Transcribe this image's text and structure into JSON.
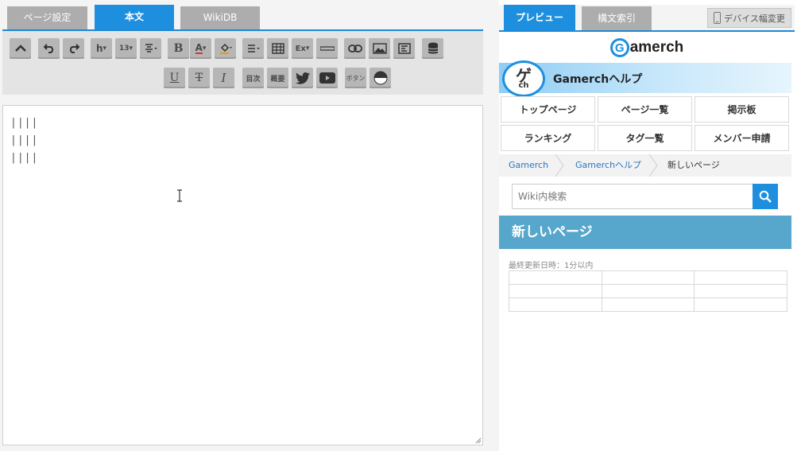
{
  "editor": {
    "tabs": [
      {
        "label": "ページ設定"
      },
      {
        "label": "本文"
      },
      {
        "label": "WikiDB"
      }
    ],
    "toolbar": {
      "heading_label": "h",
      "fontsize_label": "13",
      "bold_label": "B",
      "color_label": "A",
      "ex_label": "Ex",
      "underline_label": "U",
      "strike_label": "T",
      "italic_label": "I",
      "toc_label": "目次",
      "summary_label": "概要",
      "button_label": "ボタン"
    },
    "lines": [
      "||||",
      "||||",
      "||||"
    ]
  },
  "preview": {
    "tabs": [
      {
        "label": "プレビュー"
      },
      {
        "label": "構文索引"
      }
    ],
    "device_button": "デバイス幅変更",
    "brand": {
      "g": "G",
      "rest": "amerch"
    },
    "logo": {
      "kana": "ゲ",
      "ch": "ch"
    },
    "banner_title": "Gamerchヘルプ",
    "nav": [
      "トップページ",
      "ページ一覧",
      "掲示板",
      "ランキング",
      "タグ一覧",
      "メンバー申請"
    ],
    "breadcrumb": [
      "Gamerch",
      "Gamerchヘルプ",
      "新しいページ"
    ],
    "search_placeholder": "Wiki内検索",
    "page_title": "新しいページ",
    "updated": "最終更新日時：1分以内"
  },
  "colors": {
    "accent": "#1e8fdf",
    "tab_inactive": "#adadad",
    "page_header": "#57a6cb",
    "link": "#2a78c2"
  }
}
